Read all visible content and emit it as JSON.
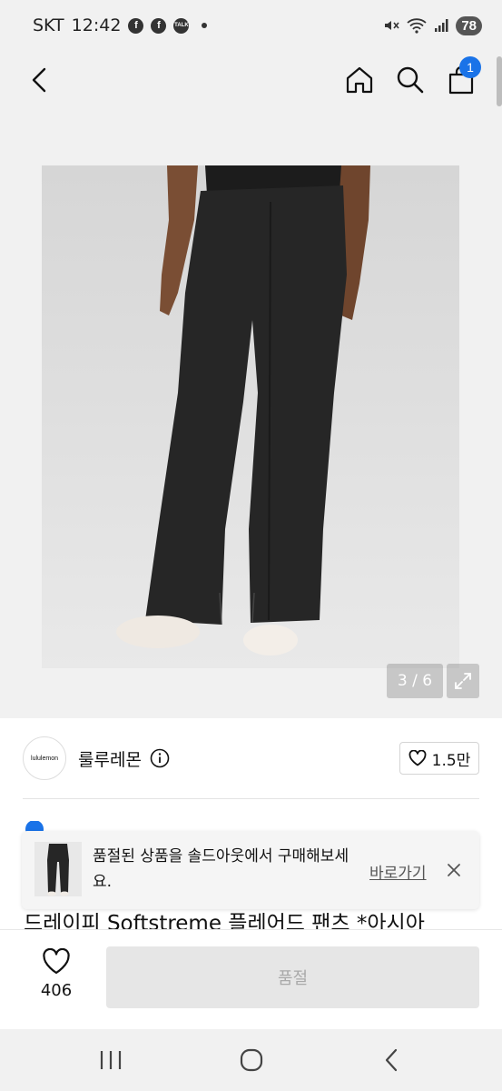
{
  "status_bar": {
    "carrier": "SKT",
    "time": "12:42",
    "notif_icons": [
      "f",
      "f",
      "TALK"
    ],
    "battery": "78"
  },
  "header": {
    "cart_count": "1"
  },
  "gallery": {
    "counter": "3 / 6"
  },
  "seller": {
    "logo_text": "lululemon",
    "name": "룰루레몬",
    "likes": "1.5만"
  },
  "toast": {
    "message": "품절된 상품을 솔드아웃에서 구매해보세요.",
    "link": "바로가기"
  },
  "product": {
    "title": "드레이피 Softstreme 플레어드 팬츠 *아시아"
  },
  "bottom_bar": {
    "wish_count": "406",
    "buy_label": "품절"
  },
  "colors": {
    "accent": "#1a73e8",
    "disabled_bg": "#e6e6e6",
    "disabled_text": "#a9a9a9"
  }
}
